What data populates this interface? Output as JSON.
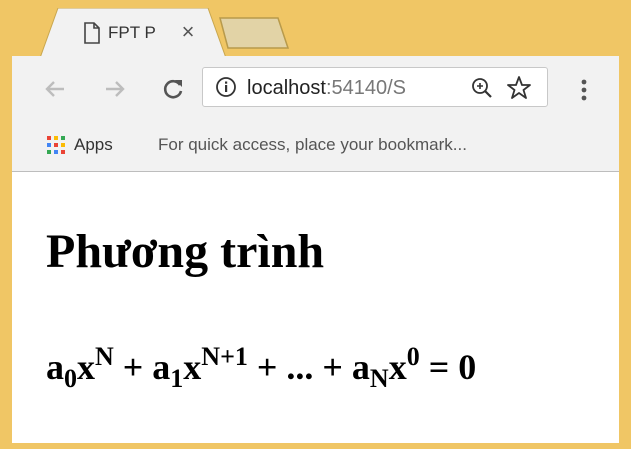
{
  "browser": {
    "tab": {
      "title": "FPT P",
      "close_glyph": "×",
      "icon": "document-icon"
    },
    "new_tab": {
      "icon": "new-tab"
    },
    "toolbar": {
      "back_icon": "arrow-left-icon",
      "forward_icon": "arrow-right-icon",
      "reload_icon": "reload-icon",
      "url_host": "localhost",
      "url_rest": ":54140/S",
      "info_icon": "info-icon",
      "zoom_icon": "zoom-in-icon",
      "star_icon": "star-icon",
      "menu_icon": "kebab-menu-icon"
    },
    "bookmarks_bar": {
      "apps_label": "Apps",
      "hint": "For quick access, place your bookmark..."
    }
  },
  "page": {
    "heading": "Phương trình",
    "equation": {
      "term0_base": "a",
      "term0_sub": "0",
      "term0_var": "x",
      "term0_sup": "N",
      "plus1": " + ",
      "term1_base": "a",
      "term1_sub": "1",
      "term1_var": "x",
      "term1_sup": "N+1",
      "middle": " + ... + ",
      "termN_base": "a",
      "termN_sub": "N",
      "termN_var": "x",
      "termN_sup": "0",
      "tail": " = 0"
    }
  },
  "colors": {
    "frame": "#f0c665",
    "toolbar": "#f2f2f2",
    "tab_active": "#f2f2f2",
    "tab_inactive": "#e0ceA0"
  }
}
